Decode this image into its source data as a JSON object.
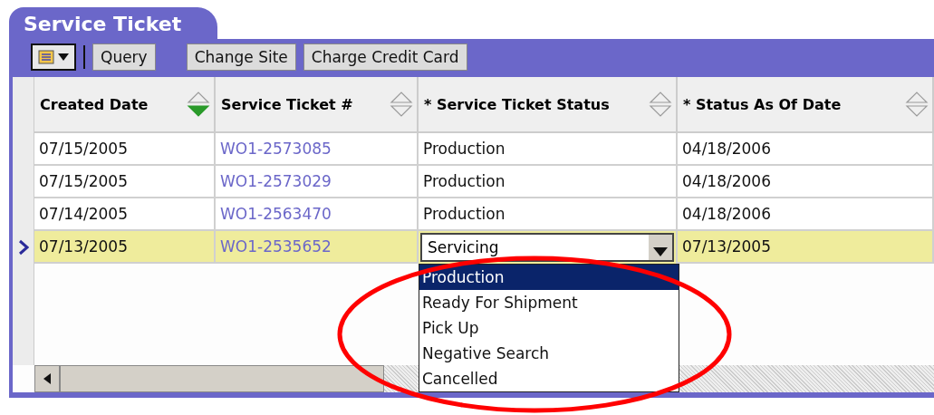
{
  "tab": {
    "title": "Service Ticket"
  },
  "toolbar": {
    "buttons": [
      {
        "label": "Query"
      },
      {
        "label": "Change Site"
      },
      {
        "label": "Charge Credit Card"
      }
    ]
  },
  "table": {
    "columns": [
      {
        "label": "Created Date",
        "sorted": true
      },
      {
        "label": "Service Ticket #",
        "sorted": false
      },
      {
        "label": "* Service Ticket Status",
        "sorted": false
      },
      {
        "label": "* Status As Of Date",
        "sorted": false
      }
    ],
    "rows": [
      {
        "selected": false,
        "created": "07/15/2005",
        "ticket": "WO1-2573085",
        "status": "Production",
        "status_date": "04/18/2006"
      },
      {
        "selected": false,
        "created": "07/15/2005",
        "ticket": "WO1-2573029",
        "status": "Production",
        "status_date": "04/18/2006"
      },
      {
        "selected": false,
        "created": "07/14/2005",
        "ticket": "WO1-2563470",
        "status": "Production",
        "status_date": "04/18/2006"
      },
      {
        "selected": true,
        "created": "07/13/2005",
        "ticket": "WO1-2535652",
        "status": "Servicing",
        "status_date": "07/13/2005",
        "status_editor": {
          "open": true,
          "options": [
            {
              "label": "Production",
              "selected": true
            },
            {
              "label": "Ready For Shipment",
              "selected": false
            },
            {
              "label": "Pick Up",
              "selected": false
            },
            {
              "label": "Negative Search",
              "selected": false
            },
            {
              "label": "Cancelled",
              "selected": false
            }
          ]
        }
      }
    ]
  },
  "annotation": {
    "kind": "ellipse"
  }
}
